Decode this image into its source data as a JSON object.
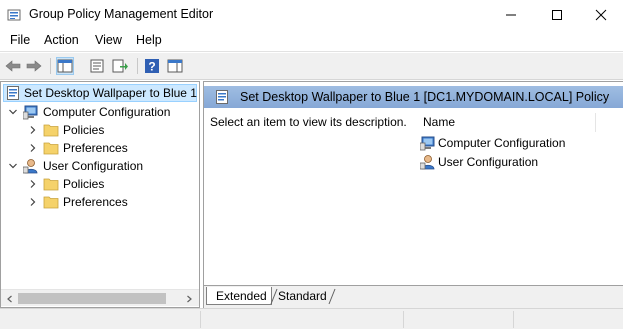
{
  "window": {
    "title": "Group Policy Management Editor"
  },
  "menu": {
    "file": "File",
    "action": "Action",
    "view": "View",
    "help": "Help"
  },
  "toolbar": {
    "icons": [
      "back-arrow-icon",
      "forward-arrow-icon",
      "show-hide-console-tree-icon",
      "properties-icon",
      "export-list-icon",
      "help-icon",
      "show-hide-action-pane-icon"
    ]
  },
  "tree": {
    "root": "Set Desktop Wallpaper to Blue 1",
    "computer_configuration": "Computer Configuration",
    "computer_policies": "Policies",
    "computer_preferences": "Preferences",
    "user_configuration": "User Configuration",
    "user_policies": "Policies",
    "user_preferences": "Preferences"
  },
  "details": {
    "header_title": "Set Desktop Wallpaper to Blue 1 [DC1.MYDOMAIN.LOCAL] Policy",
    "description": "Select an item to view its description.",
    "column_name": "Name",
    "items": [
      "Computer Configuration",
      "User Configuration"
    ]
  },
  "tabs": {
    "extended": "Extended",
    "standard": "Standard"
  },
  "colors": {
    "header_blue": "#9fbde2",
    "selection": "#cce8ff",
    "folder_yellow": "#f5d26a"
  }
}
